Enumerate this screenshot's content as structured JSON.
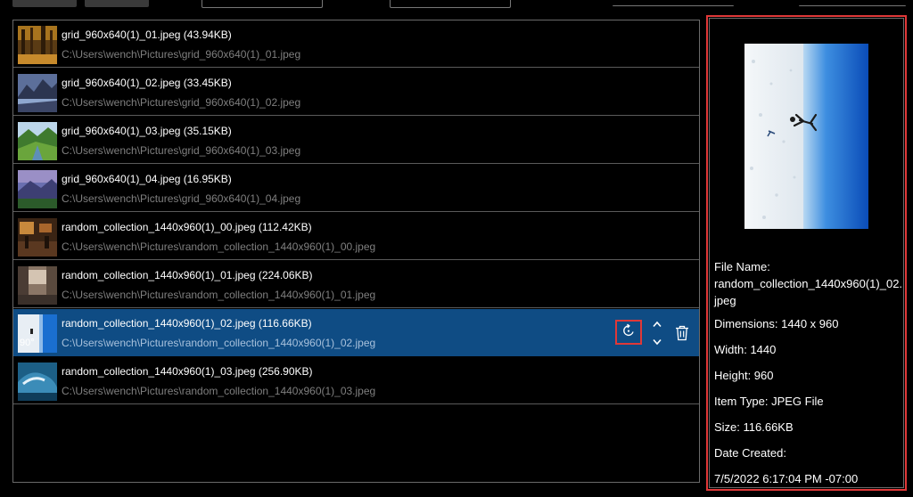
{
  "files": [
    {
      "name": "grid_960x640(1)_01.jpeg (43.94KB)",
      "path": "C:\\Users\\wench\\Pictures\\grid_960x640(1)_01.jpeg",
      "thumb": "autumn-forest"
    },
    {
      "name": "grid_960x640(1)_02.jpeg (33.45KB)",
      "path": "C:\\Users\\wench\\Pictures\\grid_960x640(1)_02.jpeg",
      "thumb": "mountain-lake"
    },
    {
      "name": "grid_960x640(1)_03.jpeg (35.15KB)",
      "path": "C:\\Users\\wench\\Pictures\\grid_960x640(1)_03.jpeg",
      "thumb": "green-valley"
    },
    {
      "name": "grid_960x640(1)_04.jpeg (16.95KB)",
      "path": "C:\\Users\\wench\\Pictures\\grid_960x640(1)_04.jpeg",
      "thumb": "purple-hills"
    },
    {
      "name": "random_collection_1440x960(1)_00.jpeg (112.42KB)",
      "path": "C:\\Users\\wench\\Pictures\\random_collection_1440x960(1)_00.jpeg",
      "thumb": "cafe-interior"
    },
    {
      "name": "random_collection_1440x960(1)_01.jpeg (224.06KB)",
      "path": "C:\\Users\\wench\\Pictures\\random_collection_1440x960(1)_01.jpeg",
      "thumb": "city-street"
    },
    {
      "name": "random_collection_1440x960(1)_02.jpeg (116.66KB)",
      "path": "C:\\Users\\wench\\Pictures\\random_collection_1440x960(1)_02.jpeg",
      "thumb": "salt-flat-sky",
      "selected": true,
      "rotation": "90°"
    },
    {
      "name": "random_collection_1440x960(1)_03.jpeg (256.90KB)",
      "path": "C:\\Users\\wench\\Pictures\\random_collection_1440x960(1)_03.jpeg",
      "thumb": "ocean-wave"
    }
  ],
  "actions": {
    "rotate_icon": "rotate-right-icon",
    "move_up_icon": "chevron-up-icon",
    "move_down_icon": "chevron-down-icon",
    "delete_icon": "trash-icon"
  },
  "details": {
    "file_name_label": "File Name:",
    "file_name_value": "random_collection_1440x960(1)_02.jpeg",
    "dimensions": "Dimensions: 1440 x 960",
    "width": "Width: 1440",
    "height": "Height: 960",
    "item_type": "Item Type: JPEG File",
    "size": "Size: 116.66KB",
    "date_created_label": "Date Created:",
    "date_created_value": "7/5/2022 6:17:04 PM -07:00"
  },
  "colors": {
    "selection": "#0f4c84",
    "highlight_border": "#e03838",
    "path_text": "#7f7f7f"
  }
}
